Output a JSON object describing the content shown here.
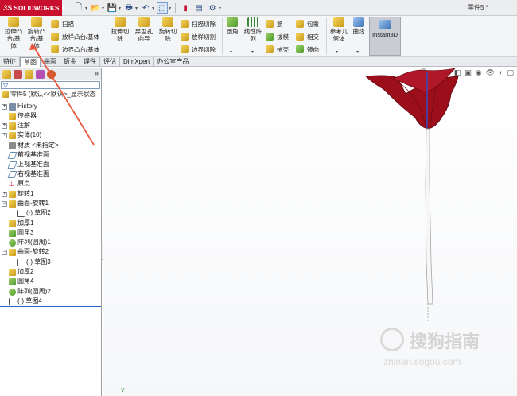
{
  "app": {
    "name": "SOLIDWORKS",
    "document_title": "零件5 *"
  },
  "colors": {
    "brand": "#c8102e",
    "flower": "#9b0e1a",
    "annotation_arrow": "#e8563f"
  },
  "ribbon": {
    "extrude_boss": "拉伸凸\n台/基\n体",
    "revolve_boss": "旋转凸\n台/基\n体",
    "sweep": "扫描",
    "loft_boss": "放样凸台/基体",
    "boundary_boss": "边界凸台/基体",
    "extrude_cut": "拉伸切\n除",
    "hole_wizard": "异型孔\n向导",
    "revolve_cut": "旋转切\n除",
    "sweep_cut": "扫描切除",
    "loft_cut": "放样切割",
    "boundary_cut": "边界切除",
    "fillet": "圆角",
    "linear_pattern": "线性阵\n列",
    "rib": "筋",
    "draft": "拔模",
    "shell": "抽壳",
    "wrap": "包覆",
    "intersect": "相交",
    "mirror": "镜向",
    "reference_geometry": "参考几\n何体",
    "curves": "曲线",
    "instant3d": "Instant3D"
  },
  "tabs": [
    "特征",
    "草图",
    "曲面",
    "钣金",
    "焊件",
    "评估",
    "DimXpert",
    "办公室产品"
  ],
  "tree": {
    "root": "零件5 (默认<<默认>_显示状态",
    "items": [
      {
        "label": "History",
        "expand": true
      },
      {
        "label": "传感器",
        "expand": false
      },
      {
        "label": "注解",
        "expand": true
      },
      {
        "label": "实体(10)",
        "expand": true
      },
      {
        "label": "材质 <未指定>",
        "expand": false
      },
      {
        "label": "前视基准面",
        "expand": false
      },
      {
        "label": "上视基准面",
        "expand": false
      },
      {
        "label": "右视基准面",
        "expand": false
      },
      {
        "label": "原点",
        "expand": false
      },
      {
        "label": "旋转1",
        "expand": true
      },
      {
        "label": "曲面-旋转1",
        "expand": true
      },
      {
        "label": "(-) 草图2",
        "expand": false
      },
      {
        "label": "加厚1",
        "expand": false
      },
      {
        "label": "圆角3",
        "expand": false
      },
      {
        "label": "阵列(圆周)1",
        "expand": false
      },
      {
        "label": "曲面-旋转2",
        "expand": true
      },
      {
        "label": "(-) 草图3",
        "expand": false
      },
      {
        "label": "加厚2",
        "expand": false
      },
      {
        "label": "圆角4",
        "expand": false
      },
      {
        "label": "阵列(圆周)2",
        "expand": false
      },
      {
        "label": "(-) 草图4",
        "expand": false
      }
    ]
  },
  "viewport": {
    "axis_label": "Y",
    "watermark_text": "搜狗指南",
    "watermark_url": "zhinan.sogou.com"
  }
}
